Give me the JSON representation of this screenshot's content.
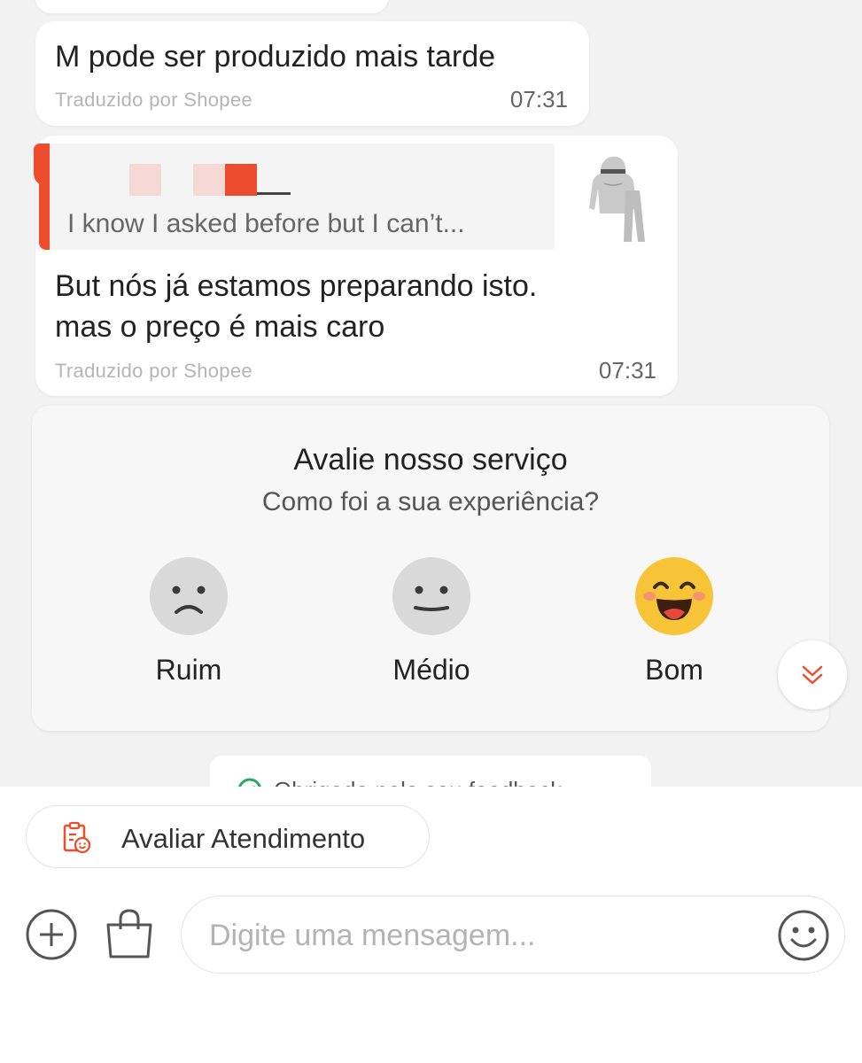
{
  "messages": [
    {
      "text": "M pode ser produzido mais tarde",
      "translated_label": "Traduzido por Shopee",
      "time": "07:31"
    },
    {
      "quote_text": "I know I asked before but I can’t...",
      "text_line1": "But nós já estamos preparando isto.",
      "text_line2": "mas o preço é mais caro",
      "translated_label": "Traduzido por Shopee",
      "time": "07:31"
    }
  ],
  "rating": {
    "title": "Avalie nosso serviço",
    "subtitle": "Como foi a sua experiência?",
    "options": [
      {
        "label": "Ruim",
        "icon": "sad-face-icon",
        "selected": false
      },
      {
        "label": "Médio",
        "icon": "neutral-face-icon",
        "selected": false
      },
      {
        "label": "Bom",
        "icon": "happy-face-icon",
        "selected": true
      }
    ]
  },
  "thanks_text": "Obrigado pelo seu feedback",
  "bottom": {
    "rate_button_label": "Avaliar Atendimento",
    "input_placeholder": "Digite uma mensagem..."
  },
  "colors": {
    "accent": "#ee4d2d",
    "happy_face": "#f7c438",
    "success_green": "#26aa63"
  }
}
